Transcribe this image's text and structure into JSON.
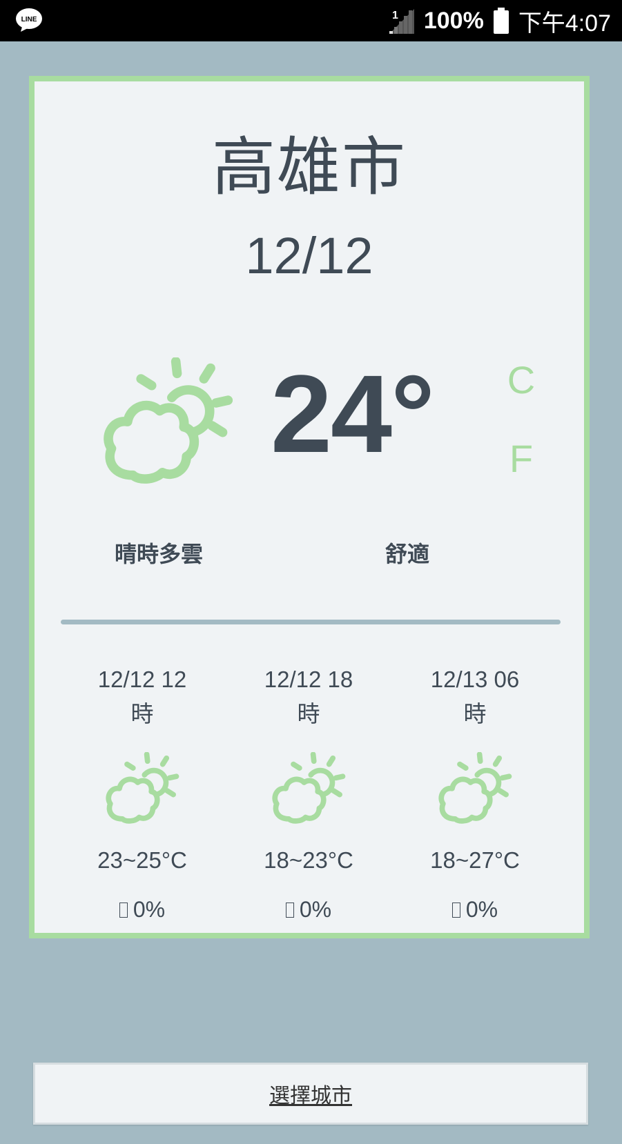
{
  "colors": {
    "background": "#a3bac3",
    "card": "#f0f3f5",
    "accent_green": "#a8dca0",
    "text_dark": "#3f4a55"
  },
  "status_bar": {
    "app_icon": "line-icon",
    "app_icon_text": "LINE",
    "signal_badge": "1",
    "battery_percent": "100%",
    "time": "下午4:07"
  },
  "weather": {
    "city": "高雄市",
    "date": "12/12",
    "icon": "partly-cloudy-icon",
    "temperature": "24°",
    "unit_c": "C",
    "unit_f": "F",
    "description": "晴時多雲",
    "comfort": "舒適"
  },
  "forecast": [
    {
      "time_line1": "12/12 12",
      "time_line2": "時",
      "icon": "partly-cloudy-icon",
      "range": "23~25°C",
      "rain_icon": "umbrella-icon",
      "rain": "0%"
    },
    {
      "time_line1": "12/12 18",
      "time_line2": "時",
      "icon": "partly-cloudy-icon",
      "range": "18~23°C",
      "rain_icon": "umbrella-icon",
      "rain": "0%"
    },
    {
      "time_line1": "12/13 06",
      "time_line2": "時",
      "icon": "partly-cloudy-icon",
      "range": "18~27°C",
      "rain_icon": "umbrella-icon",
      "rain": "0%"
    }
  ],
  "select_city_button": "選擇城市"
}
